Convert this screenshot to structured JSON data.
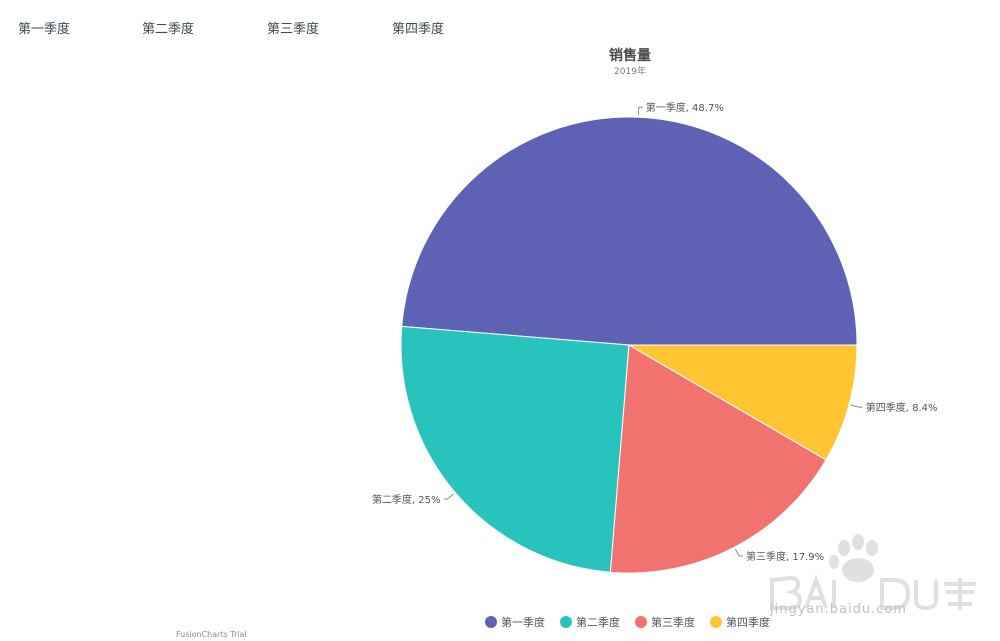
{
  "top_labels": [
    "第一季度",
    "第二季度",
    "第三季度",
    "第四季度"
  ],
  "watermark": {
    "trial_text": "FusionCharts Trial",
    "site_text": "jingyan.baidu.com"
  },
  "chart_data": {
    "type": "pie",
    "title": "销售量",
    "subtitle": "2019年",
    "categories": [
      "第一季度",
      "第二季度",
      "第三季度",
      "第四季度"
    ],
    "values": [
      48.7,
      25,
      17.9,
      8.4
    ],
    "slice_labels": [
      "第一季度, 48.7%",
      "第二季度, 25%",
      "第三季度, 17.9%",
      "第四季度, 8.4%"
    ],
    "colors": [
      "#5d62b5",
      "#29c3be",
      "#f2726f",
      "#ffc533"
    ],
    "legend": {
      "placement": "bottom",
      "entries": [
        "第一季度",
        "第二季度",
        "第三季度",
        "第四季度"
      ]
    }
  }
}
